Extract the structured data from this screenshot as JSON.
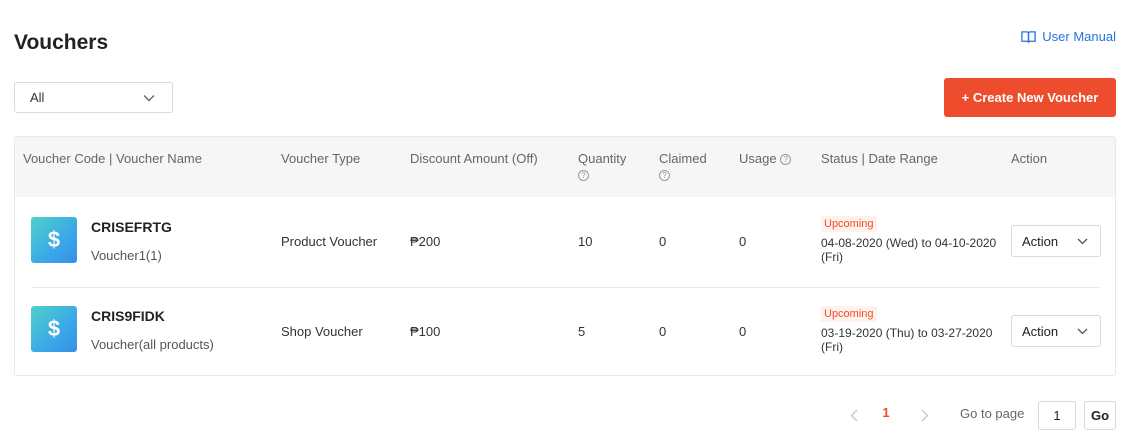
{
  "header": {
    "title": "Vouchers",
    "manual_label": "User Manual",
    "manual_icon": "book-icon"
  },
  "filter": {
    "selected": "All",
    "icon": "chevron-down-icon"
  },
  "create_button": {
    "label": "+ Create New Voucher",
    "color": "#ee4d2d"
  },
  "table": {
    "columns": {
      "code_name": "Voucher Code | Voucher Name",
      "type": "Voucher Type",
      "discount": "Discount Amount (Off)",
      "quantity": "Quantity",
      "claimed": "Claimed",
      "usage": "Usage",
      "status": "Status | Date Range",
      "action": "Action"
    },
    "help_glyph": "?",
    "rows": [
      {
        "icon_glyph": "$",
        "code": "CRISEFRTG",
        "name": "Voucher1(1)",
        "type": "Product Voucher",
        "discount": "₱200",
        "quantity": "10",
        "claimed": "0",
        "usage": "0",
        "status": "Upcoming",
        "date_range": "04-08-2020 (Wed) to 04-10-2020 (Fri)",
        "action_label": "Action"
      },
      {
        "icon_glyph": "$",
        "code": "CRIS9FIDK",
        "name": "Voucher(all products)",
        "type": "Shop Voucher",
        "discount": "₱100",
        "quantity": "5",
        "claimed": "0",
        "usage": "0",
        "status": "Upcoming",
        "date_range": "03-19-2020 (Thu) to 03-27-2020 (Fri)",
        "action_label": "Action"
      }
    ]
  },
  "pagination": {
    "current_page": "1",
    "goto_label": "Go to page",
    "goto_value": "1",
    "go_label": "Go",
    "active_color": "#ee4d2d"
  }
}
